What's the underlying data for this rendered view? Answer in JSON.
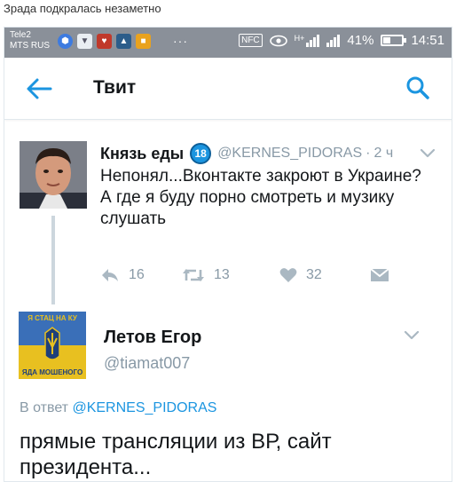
{
  "caption": "Зрада подкралась незаметно",
  "status_bar": {
    "carrier_line1": "Tele2",
    "carrier_line2": "MTS RUS",
    "dots": "···",
    "nfc_label": "NFC",
    "network_label": "H+",
    "battery_percent_text": "41%",
    "battery_level": 0.41,
    "time": "14:51",
    "notification_icons": [
      "vpn-icon",
      "shield-icon",
      "heart-app-icon",
      "app-icon",
      "lock-app-icon"
    ]
  },
  "app_bar": {
    "title": "Твит",
    "back_icon": "arrow-left-icon",
    "search_icon": "search-icon",
    "accent_color": "#1b95e0"
  },
  "tweet": {
    "display_name": "Князь еды",
    "badge": "18",
    "handle": "@KERNES_PIDORAS",
    "separator": "·",
    "time": "2 ч",
    "text_line1": "Непонял...Вконтакте закроют в Украине?",
    "text_line2": "А где я буду порно смотреть и музику слушать",
    "reply_count": "16",
    "retweet_count": "13",
    "like_count": "32"
  },
  "reply_author": {
    "display_name": "Летов Егор",
    "handle": "@tiamat007",
    "avatar_text_top": "Я СТАЦ НА КУ",
    "avatar_text_bottom": "ЯДА МОШЕНОГО"
  },
  "reply": {
    "reply_to_prefix": "В ответ",
    "reply_to_handle": "@KERNES_PIDORAS",
    "text": "прямые трансляции из ВР, сайт президента..."
  }
}
